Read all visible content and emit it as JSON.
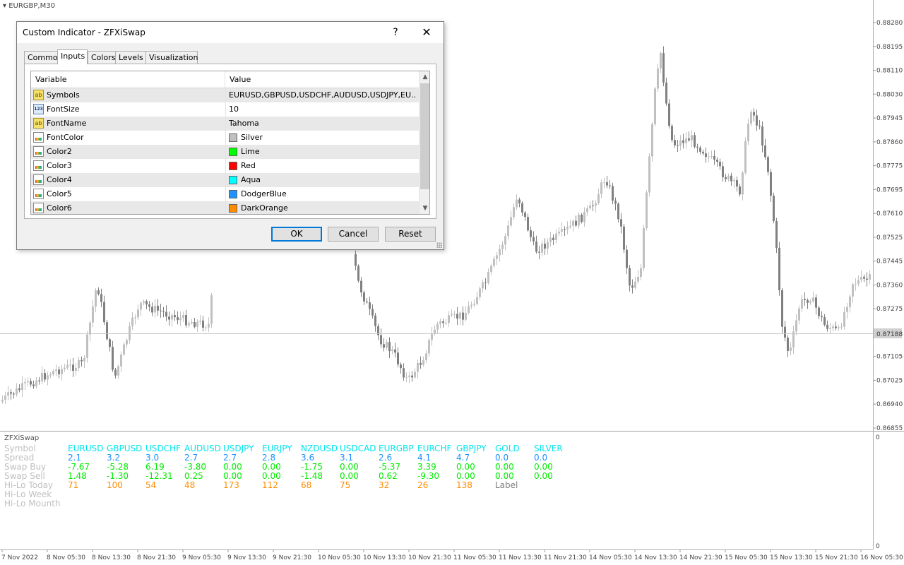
{
  "chart": {
    "symbol_label": "EURGBP,M30",
    "bid_price": "0.87188",
    "price_ticks": [
      "0.88280",
      "0.88195",
      "0.88110",
      "0.88030",
      "0.87945",
      "0.87860",
      "0.87775",
      "0.87695",
      "0.87610",
      "0.87525",
      "0.87445",
      "0.87360",
      "0.87275",
      "0.87188",
      "0.87105",
      "0.87025",
      "0.86940",
      "0.86855"
    ],
    "time_labels": [
      "7 Nov 2022",
      "8 Nov 05:30",
      "8 Nov 13:30",
      "8 Nov 21:30",
      "9 Nov 05:30",
      "9 Nov 13:30",
      "9 Nov 21:30",
      "10 Nov 05:30",
      "10 Nov 13:30",
      "10 Nov 21:30",
      "11 Nov 05:30",
      "11 Nov 13:30",
      "11 Nov 21:30",
      "14 Nov 05:30",
      "14 Nov 13:30",
      "14 Nov 21:30",
      "15 Nov 05:30",
      "15 Nov 13:30",
      "15 Nov 21:30",
      "16 Nov 05:30"
    ],
    "subwindow_title": "ZFXiSwap",
    "subwindow_scale_top": "0",
    "subwindow_scale_bottom": "0",
    "colors": {
      "bull_candle": "#c0c0c0",
      "bear_candle": "#808080",
      "grid_line": "#d0d0d0"
    }
  },
  "swap_table": {
    "row_labels": [
      "Symbol",
      "Spread",
      "Swap Buy",
      "Swap Sell",
      "Hi-Lo Today",
      "Hi-Lo Week",
      "Hi-Lo Mounth"
    ],
    "label_color": "#c0c0c0",
    "symbols": [
      "EURUSD",
      "GBPUSD",
      "USDCHF",
      "AUDUSD",
      "USDJPY",
      "EURJPY",
      "NZDUSD",
      "USDCAD",
      "EURGBP",
      "EURCHF",
      "GBPJPY",
      "GOLD",
      "SILVER"
    ],
    "symbol_color": "#00e5ee",
    "spread": [
      "2.1",
      "3.2",
      "3.0",
      "2.7",
      "2.7",
      "2.8",
      "3.6",
      "3.1",
      "2.6",
      "4.1",
      "4.7",
      "0.0",
      "0.0"
    ],
    "spread_color": "#1e90ff",
    "swap_buy": [
      "-7.67",
      "-5.28",
      "6.19",
      "-3.80",
      "0.00",
      "0.00",
      "-1.75",
      "0.00",
      "-5.37",
      "3.39",
      "0.00",
      "0.00",
      "0.00"
    ],
    "swap_sell": [
      "1.48",
      "-1.30",
      "-12.31",
      "0.25",
      "0.00",
      "0.00",
      "-1.48",
      "0.00",
      "0.62",
      "-9.30",
      "0.00",
      "0.00",
      "0.00"
    ],
    "swap_color": "#00ee00",
    "hilo_today": [
      "71",
      "100",
      "54",
      "48",
      "173",
      "112",
      "68",
      "75",
      "32",
      "26",
      "138"
    ],
    "hilo_today_color": "#ff8c00",
    "extra_label": "Label",
    "extra_label_color": "#808080"
  },
  "dialog": {
    "title": "Custom Indicator - ZFXiSwap",
    "help": "?",
    "close": "✕",
    "tabs": [
      "Common",
      "Inputs",
      "Colors",
      "Levels",
      "Visualization"
    ],
    "active_tab": "Inputs",
    "columns": {
      "variable": "Variable",
      "value": "Value"
    },
    "rows": [
      {
        "icon": "ab",
        "name": "Symbols",
        "value": "EURUSD,GBPUSD,USDCHF,AUDUSD,USDJPY,EU..."
      },
      {
        "icon": "num",
        "name": "FontSize",
        "value": "10"
      },
      {
        "icon": "ab",
        "name": "FontName",
        "value": "Tahoma"
      },
      {
        "icon": "color",
        "name": "FontColor",
        "value": "Silver",
        "swatch": "#c0c0c0"
      },
      {
        "icon": "color",
        "name": "Color2",
        "value": "Lime",
        "swatch": "#00ff00"
      },
      {
        "icon": "color",
        "name": "Color3",
        "value": "Red",
        "swatch": "#ff0000"
      },
      {
        "icon": "color",
        "name": "Color4",
        "value": "Aqua",
        "swatch": "#00ffff"
      },
      {
        "icon": "color",
        "name": "Color5",
        "value": "DodgerBlue",
        "swatch": "#1e90ff"
      },
      {
        "icon": "color",
        "name": "Color6",
        "value": "DarkOrange",
        "swatch": "#ff8c00"
      }
    ],
    "buttons": {
      "ok": "OK",
      "cancel": "Cancel",
      "reset": "Reset"
    }
  }
}
